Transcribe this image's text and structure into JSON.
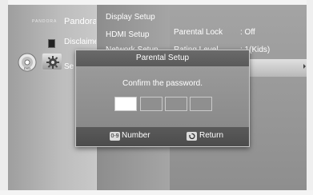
{
  "left_menu": {
    "pandora_logo_text": "PANDORA",
    "pandora_label": "Pandora",
    "disclaimer_label": "Disclaimer",
    "settings_label_partial": "Se"
  },
  "sub_menu": {
    "items": [
      "Display Setup",
      "HDMI Setup",
      "Network Setup"
    ]
  },
  "right_panel": {
    "rows": [
      {
        "label": "Parental Lock",
        "value": ": Off"
      },
      {
        "label": "Rating Level",
        "value": ": 1(Kids)"
      }
    ]
  },
  "dialog": {
    "title": "Parental Setup",
    "prompt": "Confirm the password.",
    "password_slots": 4,
    "active_slot": 1,
    "footer": {
      "number_key": "0-9",
      "number_label": "Number",
      "return_label": "Return"
    }
  },
  "colors": {
    "dialog_bg": "#8a8a8a",
    "active_slot": "#ffffff"
  }
}
